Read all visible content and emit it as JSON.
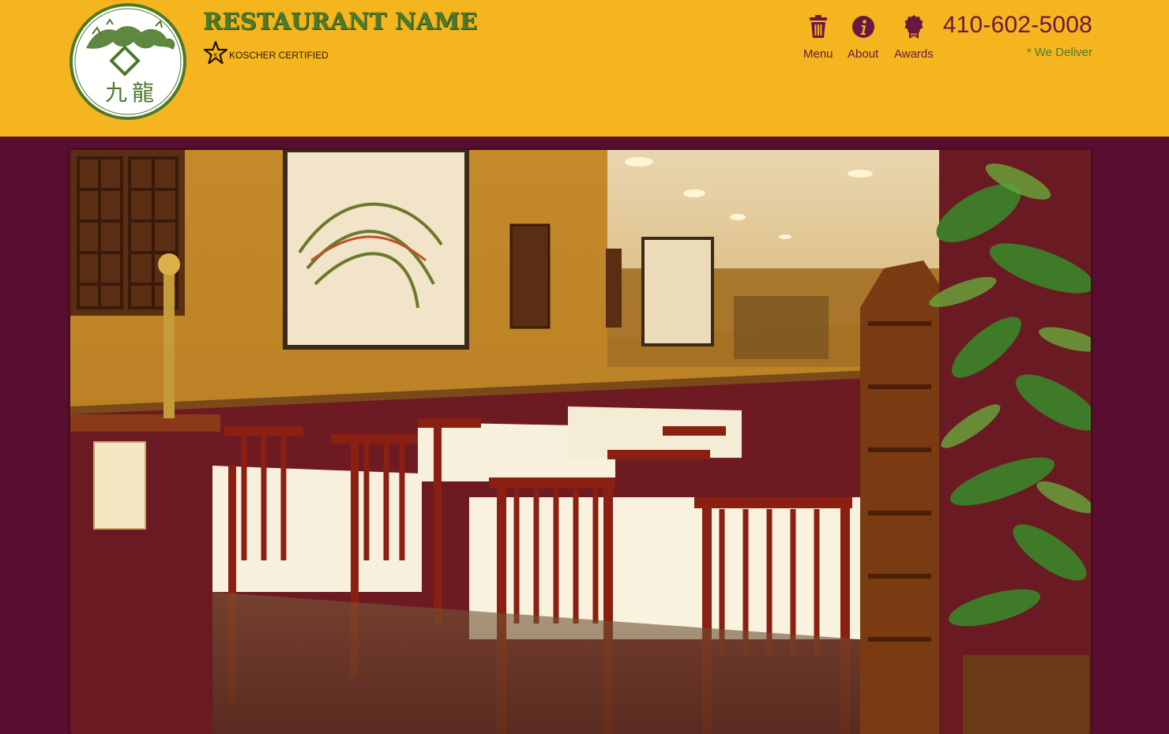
{
  "brand": {
    "name": "RESTAURANT NAME",
    "logo_characters": [
      "九",
      "龍"
    ],
    "logo_colors": {
      "ring": "#4d7a2a",
      "fill": "#ffffff",
      "dragon": "#4d7a2a"
    }
  },
  "certification": {
    "label": "KOSCHER CERTIFIED",
    "icon": "kosher-star-icon"
  },
  "nav": {
    "items": [
      {
        "label": "Menu",
        "icon": "menu-bucket-icon"
      },
      {
        "label": "About",
        "icon": "info-icon"
      },
      {
        "label": "Awards",
        "icon": "award-ribbon-icon"
      }
    ]
  },
  "contact": {
    "phone": "410-602-5008",
    "delivery_note": "* We Deliver"
  },
  "hero": {
    "subject": "restaurant-dining-room-photo"
  },
  "colors": {
    "header_bg": "#f4b51e",
    "page_bg": "#5a0f30",
    "accent_burgundy": "#6a1840",
    "accent_green": "#4d7a2a"
  }
}
